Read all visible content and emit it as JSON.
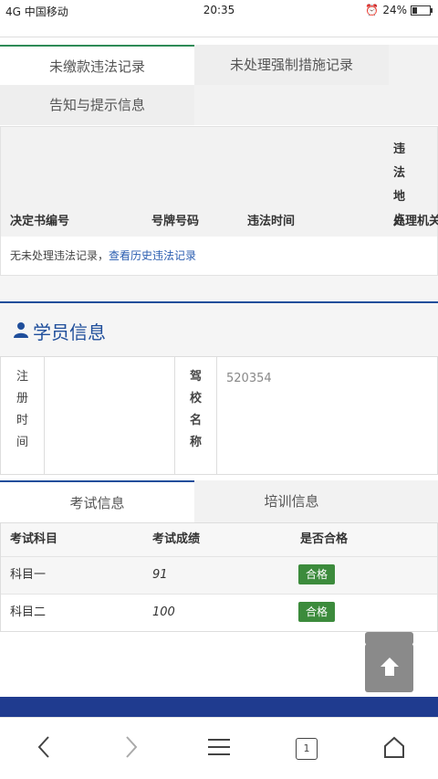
{
  "status_bar": {
    "signal": "4G",
    "carrier": "中国移动",
    "time": "20:35",
    "battery": "24%"
  },
  "violation_tabs": [
    {
      "label": "未缴款违法记录",
      "active": true
    },
    {
      "label": "未处理强制措施记录",
      "active": false
    },
    {
      "label": "告知与提示信息",
      "active": false
    }
  ],
  "violation_table": {
    "columns": [
      "决定书编号",
      "号牌号码",
      "违法时间",
      "违法 地 点",
      "处理机关"
    ],
    "empty_text": "无未处理违法记录，",
    "history_link": "查看历史违法记录"
  },
  "student": {
    "title": "学员信息",
    "reg_time_label": "注 册 时 间",
    "reg_time_value": "",
    "school_label": "驾 校 名 称",
    "school_value": "520354"
  },
  "exam_tabs": [
    {
      "label": "考试信息",
      "active": true
    },
    {
      "label": "培训信息",
      "active": false
    }
  ],
  "exam_table": {
    "headers": [
      "考试科目",
      "考试成绩",
      "是否合格"
    ],
    "rows": [
      {
        "subject": "科目一",
        "score": "91",
        "pass": "合格"
      },
      {
        "subject": "科目二",
        "score": "100",
        "pass": "合格"
      }
    ]
  },
  "colors": {
    "accent_green": "#2e8b57",
    "accent_blue": "#1f4e9b",
    "pass_green": "#3c8b3c",
    "link": "#2a5db0"
  },
  "nav": {
    "back_icon": "chevron-left-icon",
    "forward_icon": "chevron-right-icon",
    "menu_icon": "hamburger-icon",
    "tabs_icon": "tabs-icon",
    "tab_count": "1",
    "home_icon": "home-icon"
  }
}
